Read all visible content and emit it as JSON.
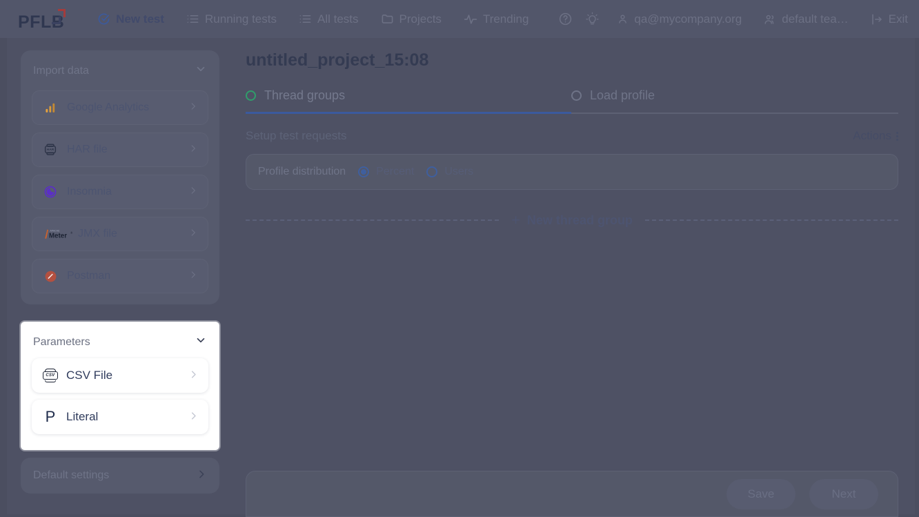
{
  "app": {
    "logo_text": "PFLB",
    "background_color": "#4e5164",
    "accent_color": "#3b5a9e"
  },
  "topnav": {
    "items": [
      {
        "label": "New test",
        "icon": "check-circle-icon",
        "active": true
      },
      {
        "label": "Running tests",
        "icon": "list-icon",
        "active": false
      },
      {
        "label": "All tests",
        "icon": "list-icon",
        "active": false
      },
      {
        "label": "Projects",
        "icon": "folder-icon",
        "active": false
      },
      {
        "label": "Trending",
        "icon": "pulse-icon",
        "active": false
      }
    ],
    "help_icon": "question-circle-icon",
    "theme_icon": "lightbulb-icon",
    "account": {
      "label": "qa@mycompany.org",
      "icon": "user-icon"
    },
    "team": {
      "label": "default tea…",
      "icon": "users-icon"
    },
    "exit": {
      "label": "Exit",
      "icon": "exit-icon"
    }
  },
  "sidebar": {
    "import_data": {
      "title": "Import data",
      "chevron": "chevron-down-icon",
      "items": [
        {
          "label": "Google Analytics",
          "icon": "google-analytics-icon",
          "arrow": "chevron-right-icon"
        },
        {
          "label": "HAR file",
          "icon": "har-file-icon",
          "arrow": "chevron-right-icon"
        },
        {
          "label": "Insomnia",
          "icon": "insomnia-icon",
          "arrow": "chevron-right-icon"
        },
        {
          "label": "JMX file",
          "icon": "jmeter-icon",
          "arrow": "chevron-right-icon"
        },
        {
          "label": "Postman",
          "icon": "postman-icon",
          "arrow": "chevron-right-icon"
        }
      ]
    },
    "parameters": {
      "title": "Parameters",
      "chevron": "chevron-down-icon",
      "highlighted": true,
      "items": [
        {
          "label": "CSV File",
          "icon": "csv-file-icon",
          "arrow": "chevron-right-icon"
        },
        {
          "label": "Literal",
          "icon": "literal-p-icon",
          "arrow": "chevron-right-icon"
        }
      ]
    },
    "default_settings": {
      "label": "Default settings",
      "arrow": "chevron-right-icon"
    }
  },
  "main": {
    "project_title": "untitled_project_15:08",
    "tabs": [
      {
        "label": "Thread groups",
        "icon": "circle-icon",
        "state_color": "#2f9e6b",
        "active": true
      },
      {
        "label": "Load profile",
        "icon": "circle-icon",
        "state_color": "#6f7488",
        "active": false
      }
    ],
    "section_title": "Setup test requests",
    "actions_label": "Actions",
    "actions_icon": "kebab-menu-icon",
    "profile_distribution": {
      "label": "Profile distribution",
      "options": [
        {
          "label": "Percent",
          "selected": true
        },
        {
          "label": "Users",
          "selected": false
        }
      ]
    },
    "new_thread_group": {
      "label": "New thread group",
      "icon": "plus-icon"
    }
  },
  "footer": {
    "save_label": "Save",
    "next_label": "Next"
  }
}
